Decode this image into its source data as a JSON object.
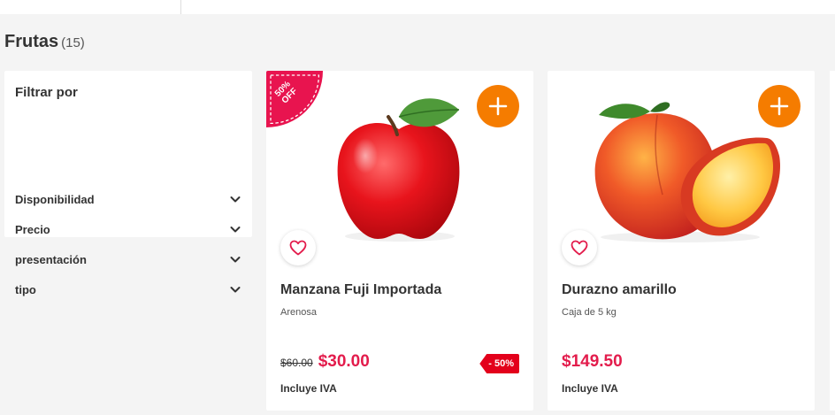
{
  "category": {
    "title": "Frutas",
    "count": "(15)"
  },
  "filters": {
    "title": "Filtrar por",
    "items": [
      {
        "label": "Disponibilidad",
        "icon": "chevron-down-icon"
      },
      {
        "label": "Precio",
        "icon": "chevron-down-icon"
      },
      {
        "label": "presentación",
        "icon": "chevron-down-icon"
      },
      {
        "label": "tipo",
        "icon": "chevron-down-icon"
      }
    ]
  },
  "products": [
    {
      "name": "Manzana Fuji Importada",
      "subtitle": "Arenosa",
      "old_price": "$60.00",
      "price": "$30.00",
      "tax_note": "Incluye IVA",
      "discount_tag": "- 50%",
      "corner_badge": {
        "line1": "50%",
        "line2": "OFF"
      },
      "image": "red-apple"
    },
    {
      "name": "Durazno amarillo",
      "subtitle": "Caja de 5 kg",
      "price": "$149.50",
      "tax_note": "Incluye IVA",
      "image": "peach"
    }
  ],
  "colors": {
    "accent_orange": "#f57c00",
    "price_red": "#e31c4c",
    "discount_red": "#e3001b",
    "badge_pink": "#e8144f"
  },
  "icons": {
    "add": "plus-icon",
    "favorite": "heart-icon"
  }
}
